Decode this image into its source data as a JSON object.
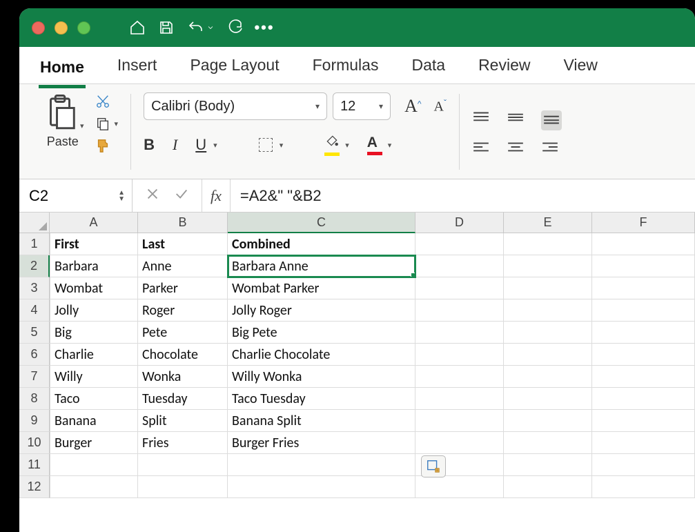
{
  "tabs": {
    "home": "Home",
    "insert": "Insert",
    "page_layout": "Page Layout",
    "formulas": "Formulas",
    "data": "Data",
    "review": "Review",
    "view": "View"
  },
  "ribbon": {
    "paste_label": "Paste",
    "font_name": "Calibri (Body)",
    "font_size": "12",
    "bold": "B",
    "italic": "I",
    "underline": "U",
    "font_color_letter": "A",
    "grow_font": "A",
    "shrink_font": "A"
  },
  "namebox": "C2",
  "fx_label": "fx",
  "formula": "=A2&\" \"&B2",
  "columns": [
    "A",
    "B",
    "C",
    "D",
    "E",
    "F"
  ],
  "selected_col": "C",
  "selected_row": 2,
  "rows": [
    {
      "n": 1,
      "A": "First",
      "B": "Last",
      "C": "Combined",
      "bold": true
    },
    {
      "n": 2,
      "A": "Barbara",
      "B": "Anne",
      "C": "Barbara Anne"
    },
    {
      "n": 3,
      "A": "Wombat",
      "B": "Parker",
      "C": "Wombat Parker"
    },
    {
      "n": 4,
      "A": "Jolly",
      "B": "Roger",
      "C": "Jolly Roger"
    },
    {
      "n": 5,
      "A": "Big",
      "B": "Pete",
      "C": "Big Pete"
    },
    {
      "n": 6,
      "A": "Charlie",
      "B": "Chocolate",
      "C": "Charlie Chocolate"
    },
    {
      "n": 7,
      "A": "Willy",
      "B": "Wonka",
      "C": "Willy Wonka"
    },
    {
      "n": 8,
      "A": "Taco",
      "B": "Tuesday",
      "C": "Taco Tuesday"
    },
    {
      "n": 9,
      "A": "Banana",
      "B": "Split",
      "C": "Banana Split"
    },
    {
      "n": 10,
      "A": "Burger",
      "B": "Fries",
      "C": "Burger Fries"
    },
    {
      "n": 11,
      "A": "",
      "B": "",
      "C": ""
    },
    {
      "n": 12,
      "A": "",
      "B": "",
      "C": ""
    }
  ]
}
